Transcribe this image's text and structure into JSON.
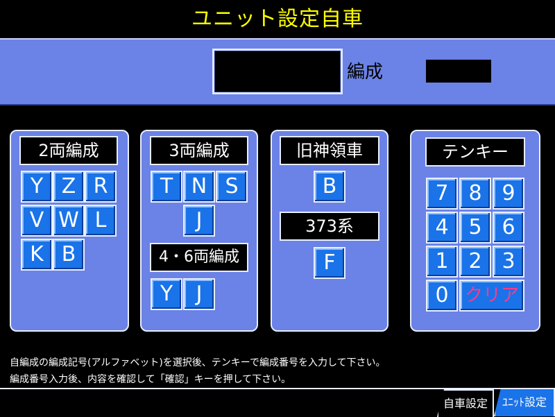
{
  "title": "ユニット設定自車",
  "header": {
    "hensei_label": "編成"
  },
  "panels": {
    "two_car": {
      "label": "2両編成",
      "keys": [
        "Y",
        "Z",
        "R",
        "V",
        "W",
        "L",
        "K",
        "B"
      ]
    },
    "three_car": {
      "label": "3両編成",
      "keys": [
        "T",
        "N",
        "S",
        "J"
      ],
      "sub_label": "4・6両編成",
      "sub_keys": [
        "Y",
        "J"
      ]
    },
    "old_shinryo": {
      "label": "旧神領車",
      "keys": [
        "B"
      ],
      "sub_label": "373系",
      "sub_keys": [
        "F"
      ]
    },
    "tenkey": {
      "label": "テンキー",
      "keys": [
        "7",
        "8",
        "9",
        "4",
        "5",
        "6",
        "1",
        "2",
        "3",
        "0"
      ],
      "clear_label": "クリア"
    }
  },
  "messages": {
    "line1": "自編成の編成記号(アルファベット)を選択後、テンキーで編成番号を入力して下さい。",
    "line2": "編成番号入力後、内容を確認して「確認」キーを押して下さい。"
  },
  "tabs": {
    "own_car": "自車設定",
    "unit": "ﾕﾆｯﾄ設定"
  },
  "colors": {
    "panel": "#6b82e6",
    "key": "#1a73e8",
    "title": "#ffff00",
    "clear_text": "#ff3a8c"
  }
}
